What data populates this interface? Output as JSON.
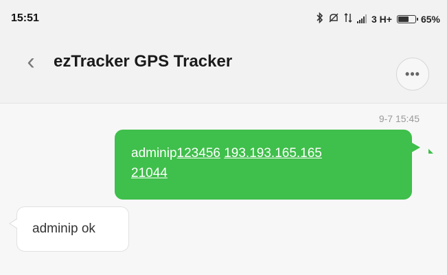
{
  "status_bar": {
    "time": "15:51",
    "network_label": "3 H+",
    "battery_percent": "65%",
    "battery_level": 0.65,
    "icons": [
      "bluetooth-icon",
      "silent-icon",
      "data-arrows-icon",
      "signal-icon",
      "battery-icon"
    ]
  },
  "header": {
    "back_icon": "‹",
    "title": "ezTracker GPS Tracker",
    "more_icon": "•••"
  },
  "messages": {
    "timestamp": "9-7 15:45",
    "sent": {
      "prefix": "adminip",
      "parts": [
        "123456",
        "193.193.165.165",
        "21044"
      ]
    },
    "received": {
      "text": "adminip ok"
    }
  },
  "colors": {
    "sent_bubble": "#3fbf4b",
    "received_bubble": "#ffffff",
    "header_bg": "#f2f2f2"
  }
}
